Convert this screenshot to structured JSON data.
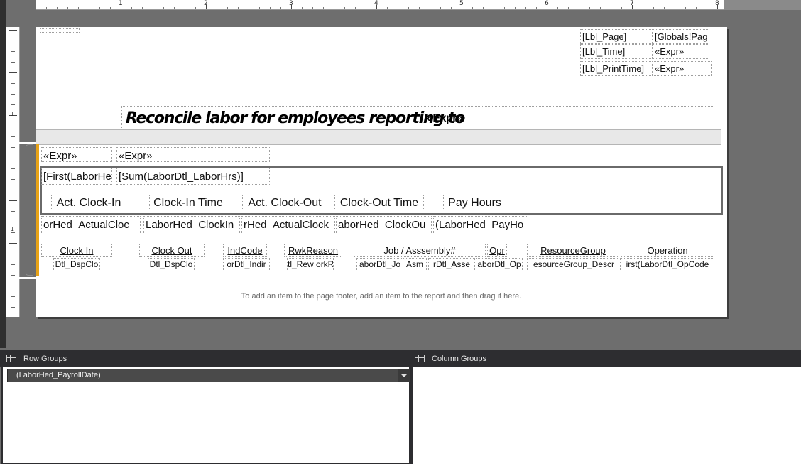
{
  "ruler": {
    "h_numbers": [
      "1",
      "2",
      "3",
      "4",
      "5",
      "6",
      "7",
      "8"
    ],
    "v_numbers": [
      "1",
      "1"
    ]
  },
  "page_header": {
    "lbl_page": "[Lbl_Page]",
    "globals_page": "[Globals!Pag",
    "lbl_time": "[Lbl_Time]",
    "expr_time": "«Expr»",
    "lbl_printtime": "[Lbl_PrintTime]",
    "expr_printtime": "«Expr»"
  },
  "title": {
    "text": "Reconcile labor for employees reporting to",
    "expr": "«Expr»"
  },
  "group_row": {
    "expr1": "«Expr»",
    "expr2": "«Expr»",
    "first_laborhed": "[First(LaborHe",
    "sum_laborhrs": "[Sum(LaborDtl_LaborHrs)]"
  },
  "labels": {
    "act_clock_in": "Act. Clock-In",
    "clock_in_time": "Clock-In Time",
    "act_clock_out": "Act. Clock-Out",
    "clock_out_time": "Clock-Out Time",
    "pay_hours": "Pay Hours"
  },
  "values": {
    "actual_clock_in": "orHed_ActualCloc",
    "clock_in": "LaborHed_ClockIn",
    "actual_clock_out": "rHed_ActualClock",
    "clock_out": "aborHed_ClockOu",
    "pay_hours": "(LaborHed_PayHo"
  },
  "detail_headers": [
    "Clock In",
    "Clock Out",
    "IndCode",
    "RwkReason",
    "Job / Asssembly#",
    "Opr",
    "ResourceGroup",
    "Operation"
  ],
  "detail_values": [
    "Dtl_DspClo",
    "Dtl_DspClo",
    "orDtl_Indir",
    "tl_Rew orkR",
    "aborDtl_Jo",
    "Asm",
    "rDtl_Asse",
    "aborDtl_Op",
    "esourceGroup_Descr",
    "irst(LaborDtl_OpCode"
  ],
  "footer_hint": "To add an item to the page footer, add an item to the report and then drag it here.",
  "panels": {
    "row_groups_title": "Row Groups",
    "column_groups_title": "Column Groups",
    "row_group_item": "(LaborHed_PayrollDate)"
  }
}
